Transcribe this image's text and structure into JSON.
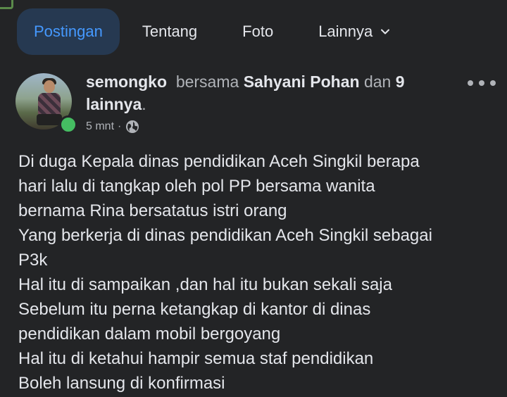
{
  "tabs": [
    {
      "label": "Postingan",
      "active": true
    },
    {
      "label": "Tentang",
      "active": false
    },
    {
      "label": "Foto",
      "active": false
    },
    {
      "label": "Lainnya",
      "active": false
    }
  ],
  "post": {
    "author": "semongko",
    "with_word": "bersama",
    "tagged": "Sahyani Pohan",
    "and_word": "dan",
    "others_count": "9",
    "others_word": "lainnya",
    "timestamp": "5 mnt",
    "separator": "·",
    "audience_icon": "globe-icon",
    "lines": [
      "Di duga Kepala dinas pendidikan Aceh Singkil berapa",
      "hari lalu di tangkap oleh pol PP  bersama wanita",
      "bernama Rina  bersatatus istri orang",
      "Yang berkerja di dinas pendidikan Aceh Singkil sebagai",
      "P3k",
      "Hal itu di sampaikan ,dan hal itu bukan sekali saja",
      "Sebelum itu perna ketangkap di kantor di dinas",
      "pendidikan dalam mobil bergoyang",
      "Hal itu di ketahui hampir semua staf pendidikan",
      "Boleh lansung di konfirmasi"
    ]
  },
  "colors": {
    "background": "#232426",
    "accent": "#4599ff",
    "active_tab_bg": "#263951",
    "online": "#45bd62"
  }
}
